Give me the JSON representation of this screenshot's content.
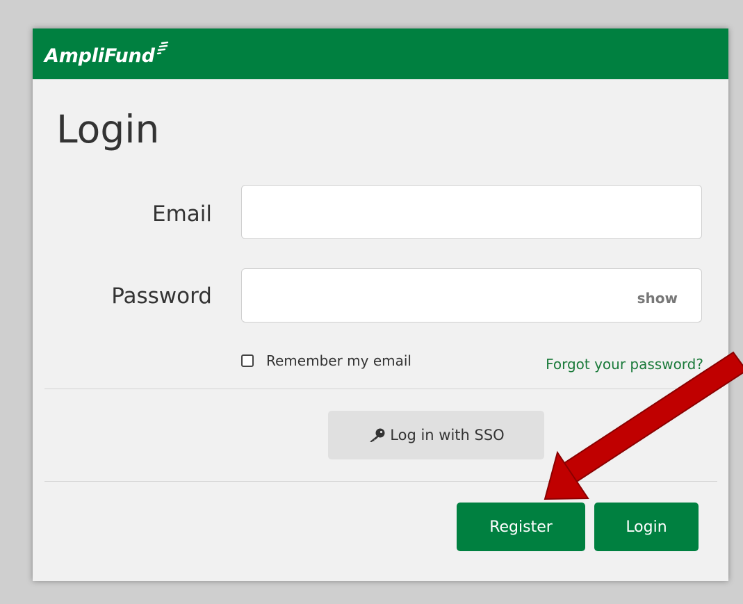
{
  "brand": {
    "name": "AmpliFund",
    "color": "#008040"
  },
  "page": {
    "title": "Login"
  },
  "form": {
    "email_label": "Email",
    "email_value": "",
    "password_label": "Password",
    "password_value": "",
    "show_toggle": "show",
    "remember_label": "Remember my email",
    "remember_checked": false,
    "forgot_link": "Forgot your password?"
  },
  "sso": {
    "label": "Log in with SSO",
    "icon": "key-icon"
  },
  "actions": {
    "register_label": "Register",
    "login_label": "Login"
  },
  "annotation": {
    "type": "arrow",
    "color": "#c00000",
    "points_to": "Register"
  }
}
